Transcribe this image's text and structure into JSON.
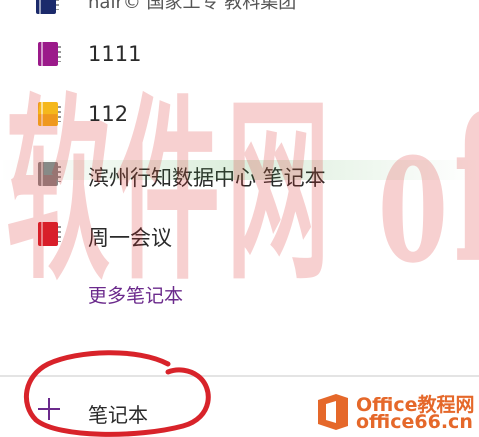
{
  "top_partial": {
    "label": "hair© 国家工专    教科集团"
  },
  "notebooks": [
    {
      "label": "1111",
      "color": "#9b1a8a",
      "icon": "notebook-icon"
    },
    {
      "label": "112",
      "color": "#f5b81c",
      "icon": "notebook-icon"
    },
    {
      "label": "滨州行知数据中心 笔记本",
      "color": "#8a8a8a",
      "icon": "notebook-icon"
    },
    {
      "label": "周一会议",
      "color": "#d81e2a",
      "icon": "notebook-icon"
    }
  ],
  "more_link": "更多笔记本",
  "add_notebook": {
    "label": "笔记本",
    "icon": "plus-icon"
  },
  "watermark": {
    "text": "软件网 office教程网",
    "stripe": ""
  },
  "logo": {
    "line1": "Office教程网",
    "line2": "office66.cn",
    "mark_color": "#e5682a"
  },
  "colors": {
    "accent": "#6b2a8c",
    "annotation_red": "#d8232a"
  }
}
